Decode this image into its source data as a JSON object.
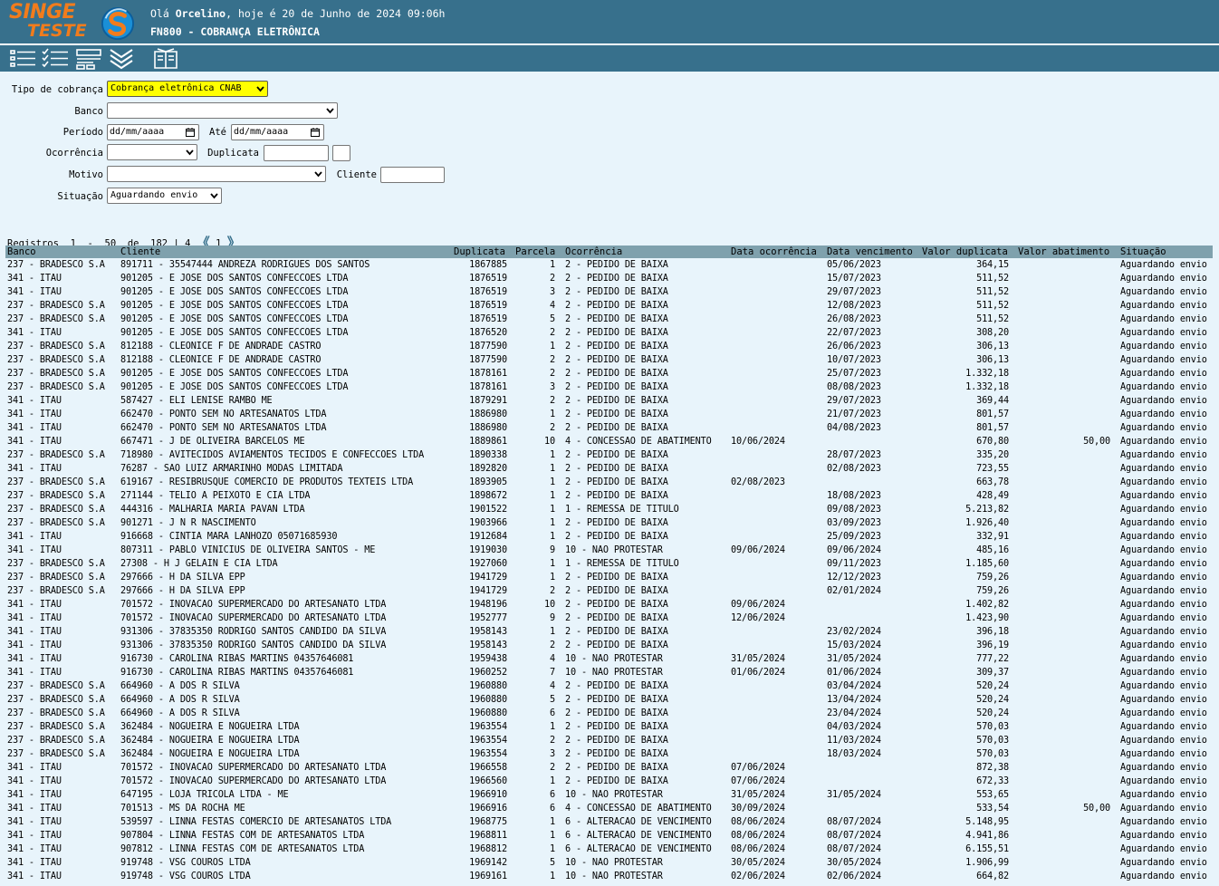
{
  "header": {
    "logo_top": "SINGE",
    "logo_bottom": "TESTE",
    "greeting_prefix": "Olá",
    "greeting_user": "Orcelino",
    "greeting_suffix": ", hoje é 20 de Junho de 2024 09:06h",
    "page_title": "FN800 - COBRANÇA ELETRÔNICA"
  },
  "toolbar": {
    "icons": [
      "list-icon",
      "checklist-icon",
      "form-icon",
      "chevron-double-down-icon",
      "book-icon"
    ]
  },
  "filters": {
    "tipo_cobranca_label": "Tipo de cobrança",
    "tipo_cobranca_value": "Cobrança eletrônica CNAB",
    "banco_label": "Banco",
    "banco_value": "",
    "periodo_label": "Período",
    "periodo_de": "dd/mm/aaaa",
    "ate_label": "Até",
    "periodo_ate": "dd/mm/aaaa",
    "ocorrencia_label": "Ocorrência",
    "ocorrencia_value": "",
    "duplicata_label": "Duplicata",
    "motivo_label": "Motivo",
    "motivo_value": "",
    "cliente_label": "Cliente",
    "situacao_label": "Situação",
    "situacao_value": "Aguardando envio"
  },
  "pagination": {
    "registros_label": "Registros",
    "from": "1",
    "dash": "-",
    "to": "50",
    "de_label": "de",
    "total": "182",
    "sep": "|",
    "pages": "4",
    "prev": "《",
    "current": "1",
    "next": "》"
  },
  "table": {
    "columns": [
      "Banco",
      "Cliente",
      "Duplicata",
      "Parcela",
      "Ocorrência",
      "Data ocorrência",
      "Data vencimento",
      "Valor duplicata",
      "Valor abatimento",
      "Situação"
    ],
    "rows": [
      [
        "237 - BRADESCO S.A",
        "891711 - 35547444 ANDREZA RODRIGUES DOS SANTOS",
        "1867885",
        "1",
        "2 - PEDIDO DE BAIXA",
        "",
        "05/06/2023",
        "364,15",
        "",
        "Aguardando envio"
      ],
      [
        "341 - ITAU",
        "901205 - E JOSE DOS SANTOS CONFECCOES LTDA",
        "1876519",
        "2",
        "2 - PEDIDO DE BAIXA",
        "",
        "15/07/2023",
        "511,52",
        "",
        "Aguardando envio"
      ],
      [
        "341 - ITAU",
        "901205 - E JOSE DOS SANTOS CONFECCOES LTDA",
        "1876519",
        "3",
        "2 - PEDIDO DE BAIXA",
        "",
        "29/07/2023",
        "511,52",
        "",
        "Aguardando envio"
      ],
      [
        "237 - BRADESCO S.A",
        "901205 - E JOSE DOS SANTOS CONFECCOES LTDA",
        "1876519",
        "4",
        "2 - PEDIDO DE BAIXA",
        "",
        "12/08/2023",
        "511,52",
        "",
        "Aguardando envio"
      ],
      [
        "237 - BRADESCO S.A",
        "901205 - E JOSE DOS SANTOS CONFECCOES LTDA",
        "1876519",
        "5",
        "2 - PEDIDO DE BAIXA",
        "",
        "26/08/2023",
        "511,52",
        "",
        "Aguardando envio"
      ],
      [
        "341 - ITAU",
        "901205 - E JOSE DOS SANTOS CONFECCOES LTDA",
        "1876520",
        "2",
        "2 - PEDIDO DE BAIXA",
        "",
        "22/07/2023",
        "308,20",
        "",
        "Aguardando envio"
      ],
      [
        "237 - BRADESCO S.A",
        "812188 - CLEONICE F DE ANDRADE CASTRO",
        "1877590",
        "1",
        "2 - PEDIDO DE BAIXA",
        "",
        "26/06/2023",
        "306,13",
        "",
        "Aguardando envio"
      ],
      [
        "237 - BRADESCO S.A",
        "812188 - CLEONICE F DE ANDRADE CASTRO",
        "1877590",
        "2",
        "2 - PEDIDO DE BAIXA",
        "",
        "10/07/2023",
        "306,13",
        "",
        "Aguardando envio"
      ],
      [
        "237 - BRADESCO S.A",
        "901205 - E JOSE DOS SANTOS CONFECCOES LTDA",
        "1878161",
        "2",
        "2 - PEDIDO DE BAIXA",
        "",
        "25/07/2023",
        "1.332,18",
        "",
        "Aguardando envio"
      ],
      [
        "237 - BRADESCO S.A",
        "901205 - E JOSE DOS SANTOS CONFECCOES LTDA",
        "1878161",
        "3",
        "2 - PEDIDO DE BAIXA",
        "",
        "08/08/2023",
        "1.332,18",
        "",
        "Aguardando envio"
      ],
      [
        "341 - ITAU",
        "587427 - ELI LENISE RAMBO ME",
        "1879291",
        "2",
        "2 - PEDIDO DE BAIXA",
        "",
        "29/07/2023",
        "369,44",
        "",
        "Aguardando envio"
      ],
      [
        "341 - ITAU",
        "662470 - PONTO SEM NO ARTESANATOS LTDA",
        "1886980",
        "1",
        "2 - PEDIDO DE BAIXA",
        "",
        "21/07/2023",
        "801,57",
        "",
        "Aguardando envio"
      ],
      [
        "341 - ITAU",
        "662470 - PONTO SEM NO ARTESANATOS LTDA",
        "1886980",
        "2",
        "2 - PEDIDO DE BAIXA",
        "",
        "04/08/2023",
        "801,57",
        "",
        "Aguardando envio"
      ],
      [
        "341 - ITAU",
        "667471 - J DE OLIVEIRA BARCELOS ME",
        "1889861",
        "10",
        "4 - CONCESSAO DE ABATIMENTO",
        "10/06/2024",
        "",
        "670,80",
        "50,00",
        "Aguardando envio"
      ],
      [
        "237 - BRADESCO S.A",
        "718980 - AVITECIDOS AVIAMENTOS TECIDOS E CONFECCOES LTDA",
        "1890338",
        "1",
        "2 - PEDIDO DE BAIXA",
        "",
        "28/07/2023",
        "335,20",
        "",
        "Aguardando envio"
      ],
      [
        "341 - ITAU",
        "76287 - SAO LUIZ ARMARINHO MODAS LIMITADA",
        "1892820",
        "1",
        "2 - PEDIDO DE BAIXA",
        "",
        "02/08/2023",
        "723,55",
        "",
        "Aguardando envio"
      ],
      [
        "237 - BRADESCO S.A",
        "619167 - RESIBRUSQUE COMERCIO DE PRODUTOS TEXTEIS LTDA",
        "1893905",
        "1",
        "2 - PEDIDO DE BAIXA",
        "02/08/2023",
        "",
        "663,78",
        "",
        "Aguardando envio"
      ],
      [
        "237 - BRADESCO S.A",
        "271144 - TELIO A PEIXOTO E CIA LTDA",
        "1898672",
        "1",
        "2 - PEDIDO DE BAIXA",
        "",
        "18/08/2023",
        "428,49",
        "",
        "Aguardando envio"
      ],
      [
        "237 - BRADESCO S.A",
        "444316 - MALHARIA MARIA PAVAN LTDA",
        "1901522",
        "1",
        "1 - REMESSA DE TITULO",
        "",
        "09/08/2023",
        "5.213,82",
        "",
        "Aguardando envio"
      ],
      [
        "237 - BRADESCO S.A",
        "901271 - J N R NASCIMENTO",
        "1903966",
        "1",
        "2 - PEDIDO DE BAIXA",
        "",
        "03/09/2023",
        "1.926,40",
        "",
        "Aguardando envio"
      ],
      [
        "341 - ITAU",
        "916668 - CINTIA MARA LANHOZO 05071685930",
        "1912684",
        "1",
        "2 - PEDIDO DE BAIXA",
        "",
        "25/09/2023",
        "332,91",
        "",
        "Aguardando envio"
      ],
      [
        "341 - ITAU",
        "807311 - PABLO VINICIUS DE OLIVEIRA SANTOS - ME",
        "1919030",
        "9",
        "10 - NAO PROTESTAR",
        "09/06/2024",
        "09/06/2024",
        "485,16",
        "",
        "Aguardando envio"
      ],
      [
        "237 - BRADESCO S.A",
        "27308 - H J GELAIN E CIA LTDA",
        "1927060",
        "1",
        "1 - REMESSA DE TITULO",
        "",
        "09/11/2023",
        "1.185,60",
        "",
        "Aguardando envio"
      ],
      [
        "237 - BRADESCO S.A",
        "297666 - H DA SILVA EPP",
        "1941729",
        "1",
        "2 - PEDIDO DE BAIXA",
        "",
        "12/12/2023",
        "759,26",
        "",
        "Aguardando envio"
      ],
      [
        "237 - BRADESCO S.A",
        "297666 - H DA SILVA EPP",
        "1941729",
        "2",
        "2 - PEDIDO DE BAIXA",
        "",
        "02/01/2024",
        "759,26",
        "",
        "Aguardando envio"
      ],
      [
        "341 - ITAU",
        "701572 - INOVACAO SUPERMERCADO DO ARTESANATO LTDA",
        "1948196",
        "10",
        "2 - PEDIDO DE BAIXA",
        "09/06/2024",
        "",
        "1.402,82",
        "",
        "Aguardando envio"
      ],
      [
        "341 - ITAU",
        "701572 - INOVACAO SUPERMERCADO DO ARTESANATO LTDA",
        "1952777",
        "9",
        "2 - PEDIDO DE BAIXA",
        "12/06/2024",
        "",
        "1.423,90",
        "",
        "Aguardando envio"
      ],
      [
        "341 - ITAU",
        "931306 - 37835350 RODRIGO SANTOS CANDIDO DA SILVA",
        "1958143",
        "1",
        "2 - PEDIDO DE BAIXA",
        "",
        "23/02/2024",
        "396,18",
        "",
        "Aguardando envio"
      ],
      [
        "341 - ITAU",
        "931306 - 37835350 RODRIGO SANTOS CANDIDO DA SILVA",
        "1958143",
        "2",
        "2 - PEDIDO DE BAIXA",
        "",
        "15/03/2024",
        "396,19",
        "",
        "Aguardando envio"
      ],
      [
        "341 - ITAU",
        "916730 - CAROLINA RIBAS MARTINS 04357646081",
        "1959438",
        "4",
        "10 - NAO PROTESTAR",
        "31/05/2024",
        "31/05/2024",
        "777,22",
        "",
        "Aguardando envio"
      ],
      [
        "341 - ITAU",
        "916730 - CAROLINA RIBAS MARTINS 04357646081",
        "1960252",
        "7",
        "10 - NAO PROTESTAR",
        "01/06/2024",
        "01/06/2024",
        "309,37",
        "",
        "Aguardando envio"
      ],
      [
        "237 - BRADESCO S.A",
        "664960 - A DOS R SILVA",
        "1960880",
        "4",
        "2 - PEDIDO DE BAIXA",
        "",
        "03/04/2024",
        "520,24",
        "",
        "Aguardando envio"
      ],
      [
        "237 - BRADESCO S.A",
        "664960 - A DOS R SILVA",
        "1960880",
        "5",
        "2 - PEDIDO DE BAIXA",
        "",
        "13/04/2024",
        "520,24",
        "",
        "Aguardando envio"
      ],
      [
        "237 - BRADESCO S.A",
        "664960 - A DOS R SILVA",
        "1960880",
        "6",
        "2 - PEDIDO DE BAIXA",
        "",
        "23/04/2024",
        "520,24",
        "",
        "Aguardando envio"
      ],
      [
        "237 - BRADESCO S.A",
        "362484 - NOGUEIRA E NOGUEIRA LTDA",
        "1963554",
        "1",
        "2 - PEDIDO DE BAIXA",
        "",
        "04/03/2024",
        "570,03",
        "",
        "Aguardando envio"
      ],
      [
        "237 - BRADESCO S.A",
        "362484 - NOGUEIRA E NOGUEIRA LTDA",
        "1963554",
        "2",
        "2 - PEDIDO DE BAIXA",
        "",
        "11/03/2024",
        "570,03",
        "",
        "Aguardando envio"
      ],
      [
        "237 - BRADESCO S.A",
        "362484 - NOGUEIRA E NOGUEIRA LTDA",
        "1963554",
        "3",
        "2 - PEDIDO DE BAIXA",
        "",
        "18/03/2024",
        "570,03",
        "",
        "Aguardando envio"
      ],
      [
        "341 - ITAU",
        "701572 - INOVACAO SUPERMERCADO DO ARTESANATO LTDA",
        "1966558",
        "2",
        "2 - PEDIDO DE BAIXA",
        "07/06/2024",
        "",
        "872,38",
        "",
        "Aguardando envio"
      ],
      [
        "341 - ITAU",
        "701572 - INOVACAO SUPERMERCADO DO ARTESANATO LTDA",
        "1966560",
        "1",
        "2 - PEDIDO DE BAIXA",
        "07/06/2024",
        "",
        "672,33",
        "",
        "Aguardando envio"
      ],
      [
        "341 - ITAU",
        "647195 - LOJA TRICOLA LTDA - ME",
        "1966910",
        "6",
        "10 - NAO PROTESTAR",
        "31/05/2024",
        "31/05/2024",
        "553,65",
        "",
        "Aguardando envio"
      ],
      [
        "341 - ITAU",
        "701513 - MS DA ROCHA ME",
        "1966916",
        "6",
        "4 - CONCESSAO DE ABATIMENTO",
        "30/09/2024",
        "",
        "533,54",
        "50,00",
        "Aguardando envio"
      ],
      [
        "341 - ITAU",
        "539597 - LINNA FESTAS COMERCIO DE ARTESANATOS LTDA",
        "1968775",
        "1",
        "6 - ALTERACAO DE VENCIMENTO",
        "08/06/2024",
        "08/07/2024",
        "5.148,95",
        "",
        "Aguardando envio"
      ],
      [
        "341 - ITAU",
        "907804 - LINNA FESTAS COM DE ARTESANATOS LTDA",
        "1968811",
        "1",
        "6 - ALTERACAO DE VENCIMENTO",
        "08/06/2024",
        "08/07/2024",
        "4.941,86",
        "",
        "Aguardando envio"
      ],
      [
        "341 - ITAU",
        "907812 - LINNA FESTAS COM DE ARTESANATOS LTDA",
        "1968812",
        "1",
        "6 - ALTERACAO DE VENCIMENTO",
        "08/06/2024",
        "08/07/2024",
        "6.155,51",
        "",
        "Aguardando envio"
      ],
      [
        "341 - ITAU",
        "919748 - VSG COUROS LTDA",
        "1969142",
        "5",
        "10 - NAO PROTESTAR",
        "30/05/2024",
        "30/05/2024",
        "1.906,99",
        "",
        "Aguardando envio"
      ],
      [
        "341 - ITAU",
        "919748 - VSG COUROS LTDA",
        "1969161",
        "1",
        "10 - NAO PROTESTAR",
        "02/06/2024",
        "02/06/2024",
        "664,82",
        "",
        "Aguardando envio"
      ]
    ]
  },
  "colors": {
    "header_bg": "#37708c",
    "logo_orange": "#f27c1c",
    "page_bg": "#e8f4fb",
    "table_header_bg": "#7fa1ad",
    "tipo_select_bg": "#ffff00"
  }
}
